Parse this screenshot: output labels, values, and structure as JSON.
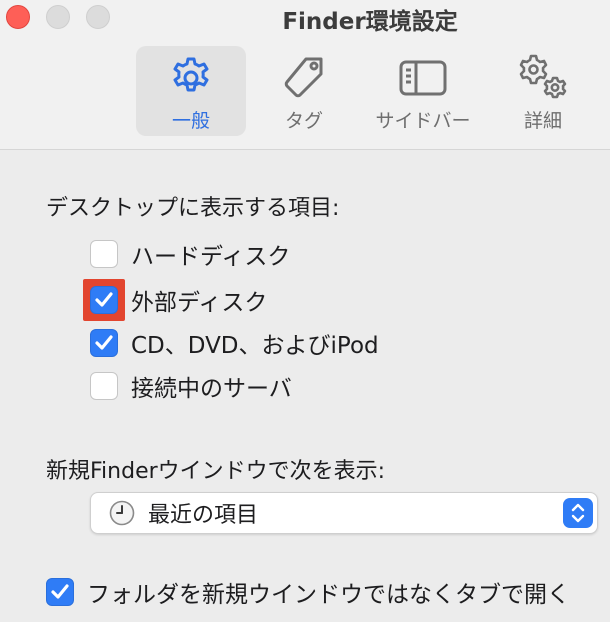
{
  "window": {
    "title": "Finder環境設定",
    "buttons": [
      "close",
      "minimize",
      "zoom"
    ]
  },
  "colors": {
    "accent": "#2f7cf6",
    "selected_tab_text": "#2f6fe0",
    "highlight": "#e2452f",
    "close_button": "#fe5f57"
  },
  "toolbar": {
    "tabs": [
      {
        "label": "一般",
        "icon": "gear-icon",
        "selected": true
      },
      {
        "label": "タグ",
        "icon": "tag-icon",
        "selected": false
      },
      {
        "label": "サイドバー",
        "icon": "sidebar-icon",
        "selected": false
      },
      {
        "label": "詳細",
        "icon": "gears-icon",
        "selected": false
      }
    ]
  },
  "desktop_items": {
    "heading": "デスクトップに表示する項目:",
    "options": [
      {
        "label": "ハードディスク",
        "checked": false
      },
      {
        "label": "外部ディスク",
        "checked": true,
        "highlighted": true
      },
      {
        "label": "CD、DVD、およびiPod",
        "checked": true
      },
      {
        "label": "接続中のサーバ",
        "checked": false
      }
    ]
  },
  "new_window": {
    "heading": "新規Finderウインドウで次を表示:",
    "selected": "最近の項目",
    "icon": "clock-icon"
  },
  "tabs_option": {
    "label": "フォルダを新規ウインドウではなくタブで開く",
    "checked": true
  }
}
